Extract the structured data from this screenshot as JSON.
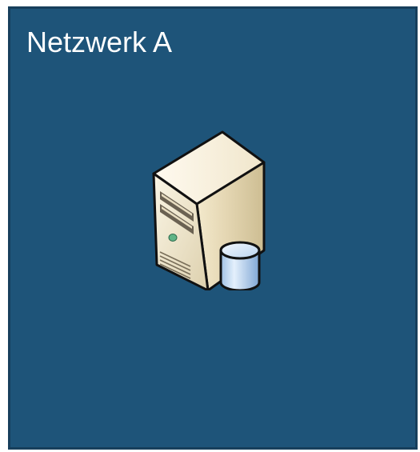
{
  "zone": {
    "title": "Netzwerk A",
    "fill_color": "#1e5479",
    "border_color": "#173f5c",
    "text_color": "#ffffff"
  },
  "nodes": [
    {
      "icon": "database-server-icon"
    }
  ]
}
